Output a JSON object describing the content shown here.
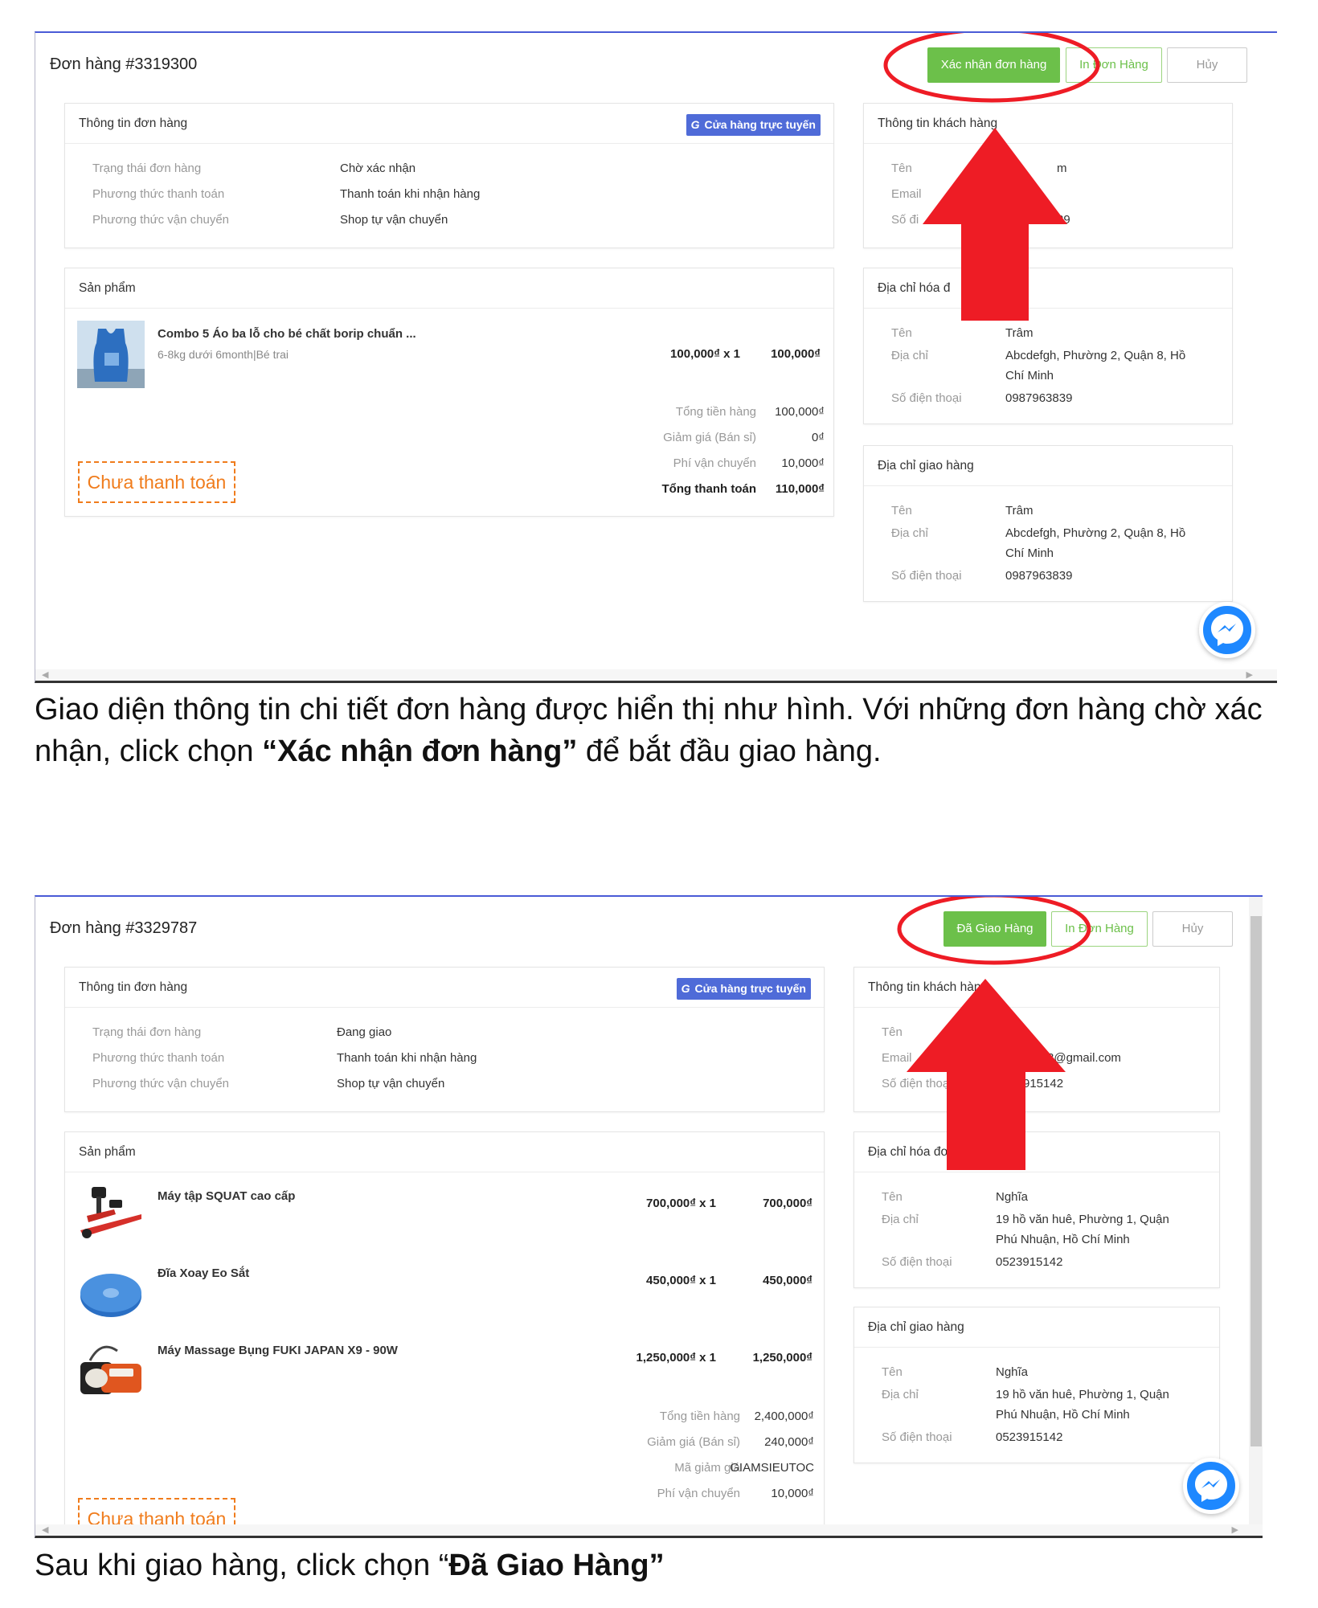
{
  "screenshots": [
    {
      "order_title": "Đơn hàng #3319300",
      "actions": [
        "Xác nhận đơn hàng",
        "In Đơn Hàng",
        "Hủy"
      ],
      "order_info": {
        "title": "Thông tin đơn hàng",
        "badge": "Cửa hàng trực tuyến",
        "badge_icon": "G",
        "rows": [
          {
            "label": "Trạng thái đơn hàng",
            "value": "Chờ xác nhận"
          },
          {
            "label": "Phương thức thanh toán",
            "value": "Thanh toán khi nhận hàng"
          },
          {
            "label": "Phương thức vận chuyển",
            "value": "Shop tự vận chuyển"
          }
        ]
      },
      "products": {
        "title": "Sản phẩm",
        "items": [
          {
            "name": "Combo 5 Áo ba lỗ cho bé chất borip chuẩn ...",
            "variant": "6-8kg dưới 6month|Bé trai",
            "qty": "100,000₫ x 1",
            "total": "100,000₫",
            "thumb": "tank-top-icon"
          }
        ],
        "summary": [
          {
            "label": "Tổng tiền hàng",
            "value": "100,000₫"
          },
          {
            "label": "Giảm giá (Bán sỉ)",
            "value": "0₫"
          },
          {
            "label": "Phí vận chuyển",
            "value": "10,000₫"
          },
          {
            "label": "Tổng thanh toán",
            "value": "110,000₫"
          }
        ],
        "payment_status": "Chưa thanh toán"
      },
      "customer": {
        "title": "Thông tin khách hàng",
        "labels": [
          "Tên",
          "Email",
          "Số điện thoại"
        ],
        "visible_fragments": [
          "m",
          "39"
        ]
      },
      "billing": {
        "title": "Địa chỉ hóa đơn",
        "name_label": "Tên",
        "name": "Trâm",
        "address_label": "Địa chỉ",
        "address": "Abcdefgh, Phường 2, Quận 8, Hồ Chí Minh",
        "phone_label": "Số điện thoại",
        "phone": "0987963839"
      },
      "shipping": {
        "title": "Địa chỉ giao hàng",
        "name_label": "Tên",
        "name": "Trâm",
        "address_label": "Địa chỉ",
        "address": "Abcdefgh, Phường 2, Quận 8, Hồ Chí Minh",
        "phone_label": "Số điện thoại",
        "phone": "0987963839"
      }
    },
    {
      "order_title": "Đơn hàng #3329787",
      "actions": [
        "Đã Giao Hàng",
        "In Đơn Hàng",
        "Hủy"
      ],
      "order_info": {
        "title": "Thông tin đơn hàng",
        "badge": "Cửa hàng trực tuyến",
        "badge_icon": "G",
        "rows": [
          {
            "label": "Trạng thái đơn hàng",
            "value": "Đang giao"
          },
          {
            "label": "Phương thức thanh toán",
            "value": "Thanh toán khi nhận hàng"
          },
          {
            "label": "Phương thức vận chuyển",
            "value": "Shop tự vận chuyển"
          }
        ]
      },
      "products": {
        "title": "Sản phẩm",
        "items": [
          {
            "name": "Máy tập SQUAT cao cấp",
            "qty": "700,000₫ x 1",
            "total": "700,000₫",
            "thumb": "squat-machine-icon"
          },
          {
            "name": "Đĩa Xoay Eo Sắt",
            "qty": "450,000₫ x 1",
            "total": "450,000₫",
            "thumb": "waist-disc-icon"
          },
          {
            "name": "Máy Massage Bụng FUKI JAPAN X9 - 90W",
            "qty": "1,250,000₫ x 1",
            "total": "1,250,000₫",
            "thumb": "massage-belt-icon"
          }
        ],
        "summary": [
          {
            "label": "Tổng tiền hàng",
            "value": "2,400,000₫"
          },
          {
            "label": "Giảm giá (Bán sỉ)",
            "value": "240,000₫"
          },
          {
            "label": "Mã giảm giá",
            "value": "GIAMSIEUTOC"
          },
          {
            "label": "Phí vận chuyển",
            "value": "10,000₫"
          }
        ],
        "payment_status": "Chưa thanh toán"
      },
      "customer": {
        "title": "Thông tin khách hàng",
        "labels": [
          "Tên",
          "Email",
          "Số điện thoại"
        ],
        "visible_fragments": [
          "8@gmail.com",
          "915142"
        ]
      },
      "billing": {
        "title": "Địa chỉ hóa đơn",
        "name_label": "Tên",
        "name": "Nghĩa",
        "address_label": "Địa chỉ",
        "address": "19 hồ văn huê, Phường 1, Quận Phú Nhuận, Hồ Chí Minh",
        "phone_label": "Số điện thoại",
        "phone": "0523915142"
      },
      "shipping": {
        "title": "Địa chỉ giao hàng",
        "name_label": "Tên",
        "name": "Nghĩa",
        "address_label": "Địa chỉ",
        "address": "19 hồ văn huê, Phường 1, Quận Phú Nhuận, Hồ Chí Minh",
        "phone_label": "Số điện thoại",
        "phone": "0523915142"
      }
    }
  ],
  "captions": {
    "first_a": "Giao diện thông tin chi tiết đơn hàng được hiển thị như hình. Với những đơn hàng chờ xác nhận, click chọn ",
    "first_bold": "“Xác nhận đơn hàng”",
    "first_b": " để bắt đầu giao hàng.",
    "second_a": "Sau khi giao hàng, click chọn “",
    "second_bold": "Đã Giao Hàng”"
  },
  "colors": {
    "accent_green": "#6cc04a",
    "badge_blue": "#4f6bd8",
    "unpaid_orange": "#f07c1c",
    "annotation_red": "#ee1c25",
    "messenger_blue": "#1e88ff"
  }
}
